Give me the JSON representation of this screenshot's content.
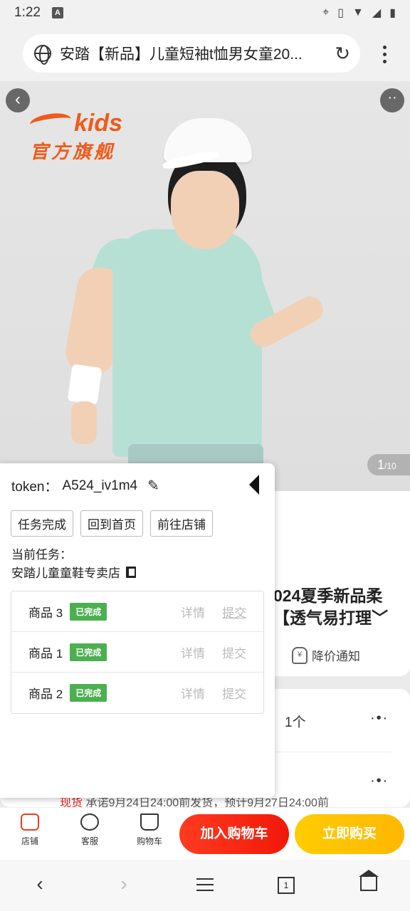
{
  "status": {
    "time": "1:22",
    "badge": "A"
  },
  "browser": {
    "url": "安踏【新品】儿童短袖t恤男女童20...",
    "reload_glyph": "↻"
  },
  "hero": {
    "brand_en": "kids",
    "brand_cn": "官方旗舰",
    "page_current": "1",
    "page_total": "/10"
  },
  "product": {
    "title_line1": "024夏季新品柔",
    "title_line2": "【透气易打理﹀",
    "price_alert": "降价通知",
    "price_alert_icon": "¥",
    "qty": "1个",
    "delivery_label": "现货",
    "delivery_text": "承诺9月24日24:00前发货，预计9月27日24:00前"
  },
  "panel": {
    "token_label": "token：",
    "token_value": "A524_iv1m4",
    "buttons": [
      "任务完成",
      "回到首页",
      "前往店铺"
    ],
    "task_label": "当前任务：",
    "task_store": "安踏儿童童鞋专卖店",
    "goods": [
      {
        "name": "商品 3",
        "status": "已完成",
        "detail": "详情",
        "submit": "提交"
      },
      {
        "name": "商品 1",
        "status": "已完成",
        "detail": "详情",
        "submit": "提交"
      },
      {
        "name": "商品 2",
        "status": "已完成",
        "detail": "详情",
        "submit": "提交"
      }
    ]
  },
  "actionbar": {
    "store": "店铺",
    "service": "客服",
    "cart": "购物车",
    "add_to_cart": "加入购物车",
    "buy_now": "立即购买"
  },
  "nav": {
    "tab_count": "1"
  }
}
